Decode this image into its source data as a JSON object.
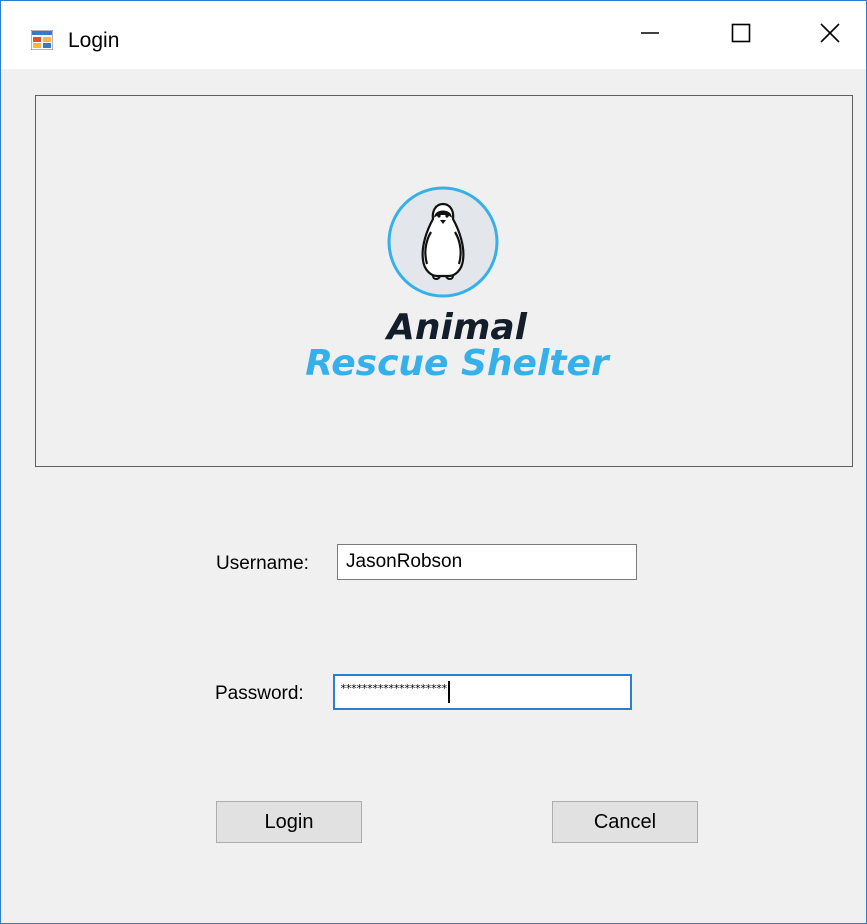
{
  "window": {
    "title": "Login"
  },
  "brand": {
    "line1": "Animal",
    "line2": "Rescue Shelter"
  },
  "form": {
    "username_label": "Username:",
    "username_value": "JasonRobson",
    "password_label": "Password:",
    "password_mask": "********************"
  },
  "buttons": {
    "login_label": "Login",
    "cancel_label": "Cancel"
  },
  "colors": {
    "window_border": "#2b7fd1",
    "brand_dark": "#141e2b",
    "brand_blue": "#36b0ea",
    "focus_border": "#2b7fd1"
  },
  "icons": {
    "app": "windows-form-icon",
    "logo": "penguin-icon",
    "minimize": "minimize-icon",
    "maximize": "maximize-icon",
    "close": "close-icon"
  }
}
